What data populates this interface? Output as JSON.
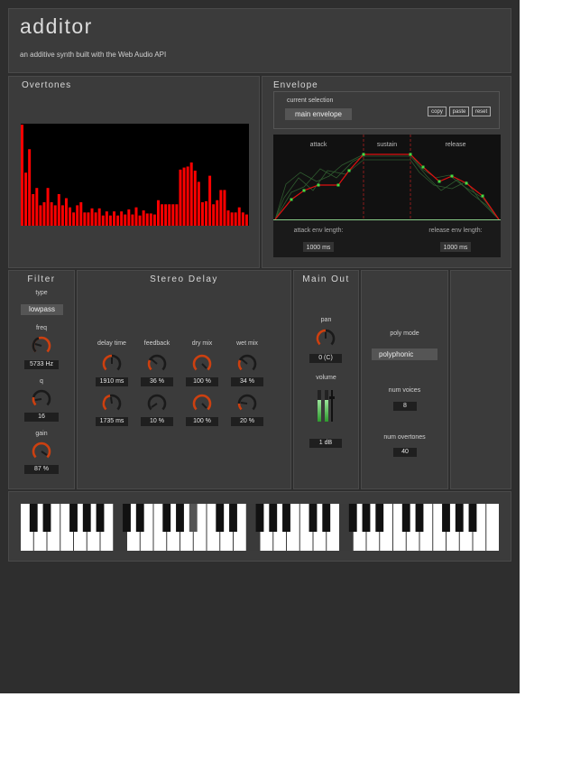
{
  "header": {
    "title": "additor",
    "subtitle": "an additive synth built with the Web Audio API"
  },
  "overtones": {
    "title": "Overtones",
    "values": [
      0.99,
      0.52,
      0.75,
      0.31,
      0.37,
      0.2,
      0.23,
      0.37,
      0.23,
      0.2,
      0.31,
      0.2,
      0.27,
      0.18,
      0.13,
      0.2,
      0.23,
      0.13,
      0.13,
      0.17,
      0.13,
      0.17,
      0.1,
      0.14,
      0.1,
      0.14,
      0.1,
      0.14,
      0.11,
      0.16,
      0.11,
      0.18,
      0.1,
      0.15,
      0.12,
      0.12,
      0.11,
      0.25,
      0.21,
      0.21,
      0.21,
      0.21,
      0.21,
      0.55,
      0.57,
      0.58,
      0.62,
      0.54,
      0.43,
      0.23,
      0.24,
      0.49,
      0.21,
      0.25,
      0.35,
      0.35,
      0.15,
      0.13,
      0.13,
      0.18,
      0.13,
      0.11
    ],
    "bar_color": "#ff0000"
  },
  "envelope": {
    "title": "Envelope",
    "current_selection_label": "current selection",
    "current_selection_value": "main envelope",
    "copy_label": "copy",
    "paste_label": "paste",
    "reset_label": "reset",
    "attack_label": "attack",
    "sustain_label": "sustain",
    "release_label": "release",
    "attack_length_label": "attack env length:",
    "attack_length_value": "1000 ms",
    "release_length_label": "release env length:",
    "release_length_value": "1000 ms"
  },
  "filter": {
    "title": "Filter",
    "type_label": "type",
    "type_value": "lowpass",
    "freq_label": "freq",
    "freq_value": "5733 Hz",
    "q_label": "q",
    "q_value": "16",
    "gain_label": "gain",
    "gain_value": "87 %"
  },
  "delay": {
    "title": "Stereo Delay",
    "columns": [
      {
        "label": "delay time",
        "top": "1910 ms",
        "bottom": "1735 ms"
      },
      {
        "label": "feedback",
        "top": "36 %",
        "bottom": "10 %"
      },
      {
        "label": "dry mix",
        "top": "100 %",
        "bottom": "100 %"
      },
      {
        "label": "wet mix",
        "top": "34 %",
        "bottom": "20 %"
      }
    ]
  },
  "main_out": {
    "title": "Main Out",
    "pan_label": "pan",
    "pan_value": "0 (C)",
    "volume_label": "volume",
    "volume_value": "1 dB"
  },
  "poly": {
    "mode_label": "poly mode",
    "mode_value": "polyphonic",
    "voices_label": "num voices",
    "voices_value": "8",
    "overtones_label": "num overtones",
    "overtones_value": "40"
  },
  "colors": {
    "accent": "#cc4010",
    "background": "#2e2e2e",
    "panel": "#3b3b3b"
  }
}
